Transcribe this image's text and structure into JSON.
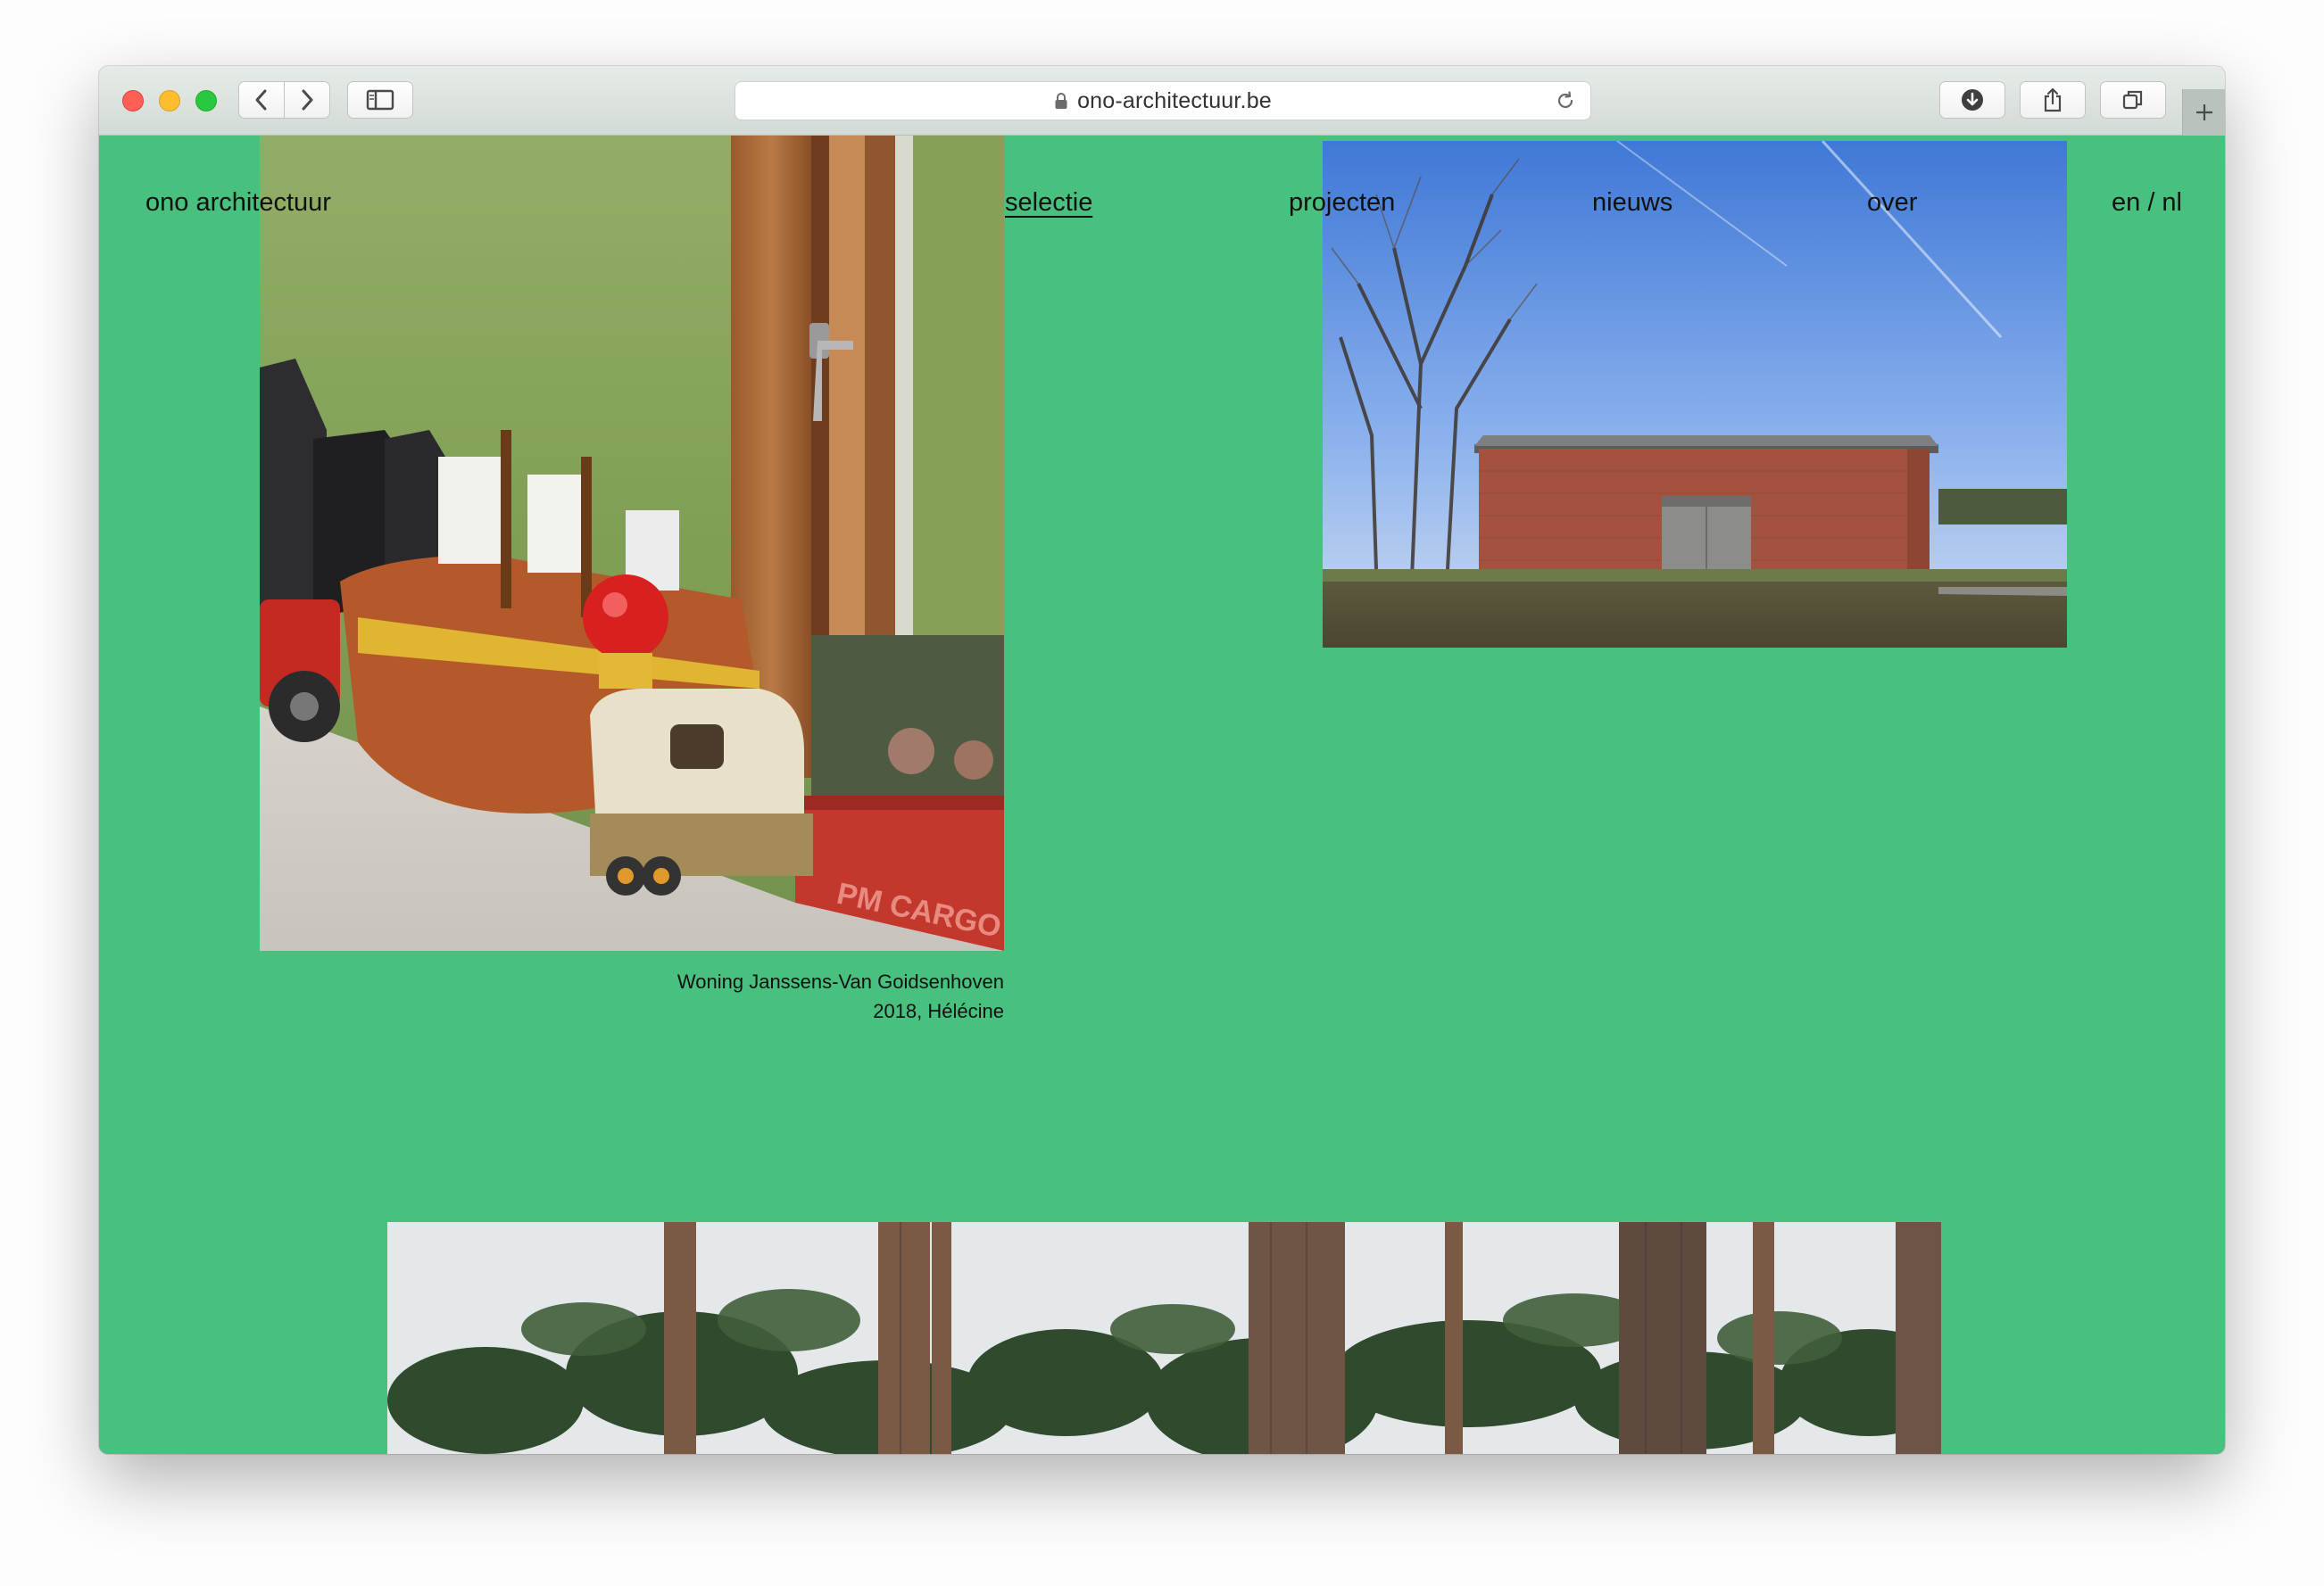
{
  "browser": {
    "url": "ono-architectuur.be",
    "buttons": {
      "back": "chevron-left-icon",
      "forward": "chevron-right-icon",
      "sidebar": "sidebar-icon",
      "download": "download-icon",
      "share": "share-icon",
      "tabs": "tabs-overview-icon",
      "new_tab": "plus-icon"
    }
  },
  "site": {
    "brand": "ono architectuur",
    "nav": {
      "selectie": "selectie",
      "projecten": "projecten",
      "nieuws": "nieuws",
      "over": "over",
      "language": "en / nl"
    },
    "active_nav": "selectie",
    "background_color": "#48c17f"
  },
  "projects": [
    {
      "title": "Woning Janssens-Van Goidsenhoven",
      "meta": "2018, Hélécine",
      "image": "toys-on-windowsill-photo"
    },
    {
      "image": "brick-barn-photo"
    },
    {
      "image": "pine-forest-photo"
    }
  ]
}
